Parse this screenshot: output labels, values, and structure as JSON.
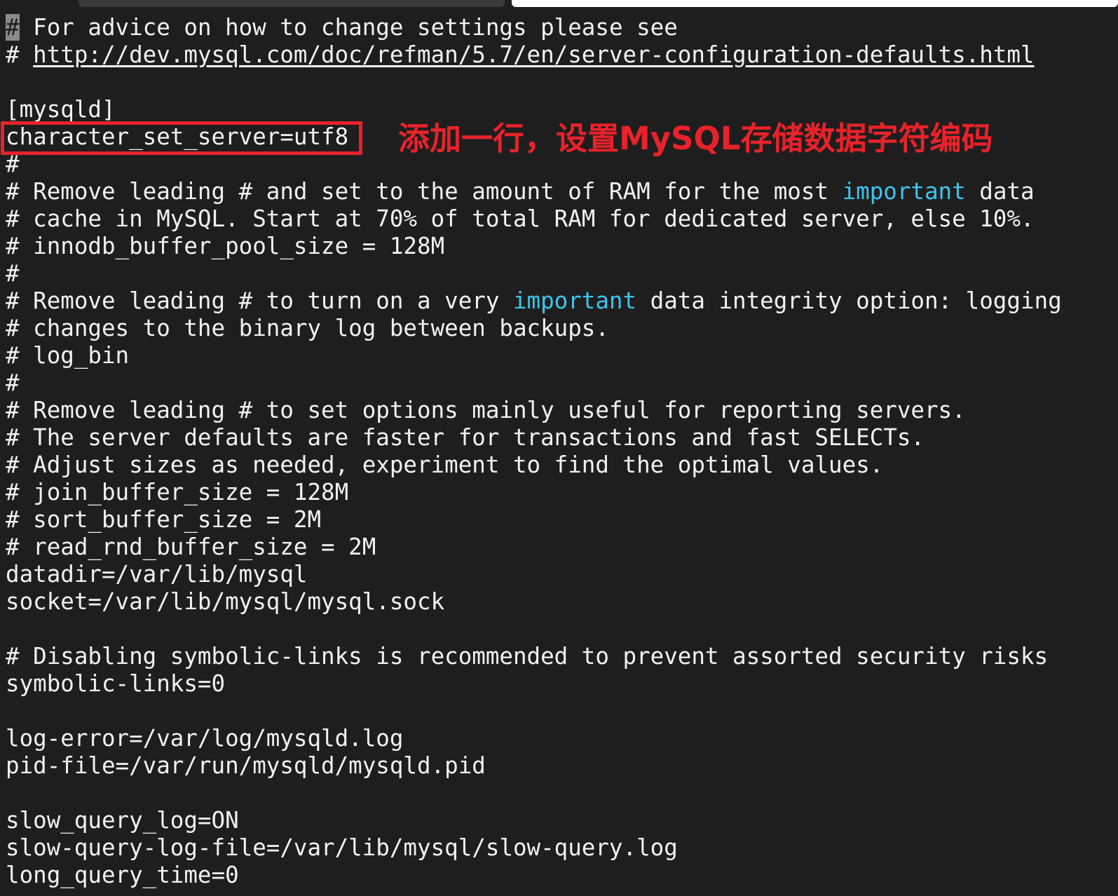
{
  "editor": {
    "cursor_char": "#",
    "lines": [
      {
        "segments": [
          {
            "text": " For advice on how to change settings please see",
            "kind": "normal"
          }
        ]
      },
      {
        "segments": [
          {
            "text": "# ",
            "kind": "normal"
          },
          {
            "text": "http://dev.mysql.com/doc/refman/5.7/en/server-configuration-defaults.html",
            "kind": "url"
          }
        ]
      },
      {
        "segments": [
          {
            "text": "",
            "kind": "normal"
          }
        ]
      },
      {
        "segments": [
          {
            "text": "[mysqld]",
            "kind": "normal"
          }
        ]
      },
      {
        "segments": [
          {
            "text": "character_set_server=utf8",
            "kind": "normal"
          }
        ]
      },
      {
        "segments": [
          {
            "text": "#",
            "kind": "normal"
          }
        ]
      },
      {
        "segments": [
          {
            "text": "# Remove leading # and set to the amount of RAM for the most ",
            "kind": "normal"
          },
          {
            "text": "important",
            "kind": "keyword"
          },
          {
            "text": " data",
            "kind": "normal"
          }
        ]
      },
      {
        "segments": [
          {
            "text": "# cache in MySQL. Start at 70% of total RAM for dedicated server, else 10%.",
            "kind": "normal"
          }
        ]
      },
      {
        "segments": [
          {
            "text": "# innodb_buffer_pool_size = 128M",
            "kind": "normal"
          }
        ]
      },
      {
        "segments": [
          {
            "text": "#",
            "kind": "normal"
          }
        ]
      },
      {
        "segments": [
          {
            "text": "# Remove leading # to turn on a very ",
            "kind": "normal"
          },
          {
            "text": "important",
            "kind": "keyword"
          },
          {
            "text": " data integrity option: logging",
            "kind": "normal"
          }
        ]
      },
      {
        "segments": [
          {
            "text": "# changes to the binary log between backups.",
            "kind": "normal"
          }
        ]
      },
      {
        "segments": [
          {
            "text": "# log_bin",
            "kind": "normal"
          }
        ]
      },
      {
        "segments": [
          {
            "text": "#",
            "kind": "normal"
          }
        ]
      },
      {
        "segments": [
          {
            "text": "# Remove leading # to set options mainly useful for reporting servers.",
            "kind": "normal"
          }
        ]
      },
      {
        "segments": [
          {
            "text": "# The server defaults are faster for transactions and fast SELECTs.",
            "kind": "normal"
          }
        ]
      },
      {
        "segments": [
          {
            "text": "# Adjust sizes as needed, experiment to find the optimal values.",
            "kind": "normal"
          }
        ]
      },
      {
        "segments": [
          {
            "text": "# join_buffer_size = 128M",
            "kind": "normal"
          }
        ]
      },
      {
        "segments": [
          {
            "text": "# sort_buffer_size = 2M",
            "kind": "normal"
          }
        ]
      },
      {
        "segments": [
          {
            "text": "# read_rnd_buffer_size = 2M",
            "kind": "normal"
          }
        ]
      },
      {
        "segments": [
          {
            "text": "datadir=/var/lib/mysql",
            "kind": "normal"
          }
        ]
      },
      {
        "segments": [
          {
            "text": "socket=/var/lib/mysql/mysql.sock",
            "kind": "normal"
          }
        ]
      },
      {
        "segments": [
          {
            "text": "",
            "kind": "normal"
          }
        ]
      },
      {
        "segments": [
          {
            "text": "# Disabling symbolic-links is recommended to prevent assorted security risks",
            "kind": "normal"
          }
        ]
      },
      {
        "segments": [
          {
            "text": "symbolic-links=0",
            "kind": "normal"
          }
        ]
      },
      {
        "segments": [
          {
            "text": "",
            "kind": "normal"
          }
        ]
      },
      {
        "segments": [
          {
            "text": "log-error=/var/log/mysqld.log",
            "kind": "normal"
          }
        ]
      },
      {
        "segments": [
          {
            "text": "pid-file=/var/run/mysqld/mysqld.pid",
            "kind": "normal"
          }
        ]
      },
      {
        "segments": [
          {
            "text": "",
            "kind": "normal"
          }
        ]
      },
      {
        "segments": [
          {
            "text": "slow_query_log=ON",
            "kind": "normal"
          }
        ]
      },
      {
        "segments": [
          {
            "text": "slow-query-log-file=/var/lib/mysql/slow-query.log",
            "kind": "normal"
          }
        ]
      },
      {
        "segments": [
          {
            "text": "long_query_time=0",
            "kind": "normal"
          }
        ]
      }
    ]
  },
  "annotation": {
    "text": "添加一行，设置MySQL存储数据字符编码",
    "color": "#e8222a"
  },
  "colors": {
    "background": "#1e1e1e",
    "text": "#f2f2f2",
    "keyword": "#3cc5ee",
    "highlight_box": "#e8222a"
  }
}
